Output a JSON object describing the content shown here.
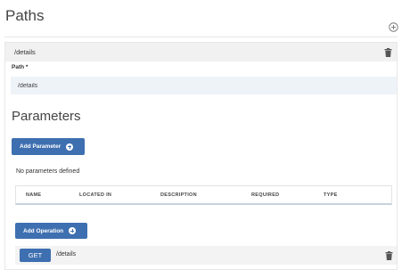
{
  "paths": {
    "title": "Paths"
  },
  "path_item": {
    "header": "/details",
    "field_label": "Path *",
    "path_value": "/details"
  },
  "parameters": {
    "title": "Parameters",
    "add_button": "Add Parameter",
    "empty_text": "No parameters defined",
    "columns": [
      "NAME",
      "LOCATED IN",
      "DESCRIPTION",
      "REQUIRED",
      "TYPE"
    ]
  },
  "operations": {
    "add_button": "Add Operation",
    "items": [
      {
        "method": "GET",
        "path": "/details"
      }
    ]
  },
  "icons": {
    "add_path": "plus-circle-icon",
    "delete": "trash-icon",
    "add": "plus-circle-filled-icon"
  },
  "colors": {
    "primary_button": "#3e6fb0",
    "header_bg": "#f1f1f1",
    "input_bg": "#eef3f8"
  }
}
